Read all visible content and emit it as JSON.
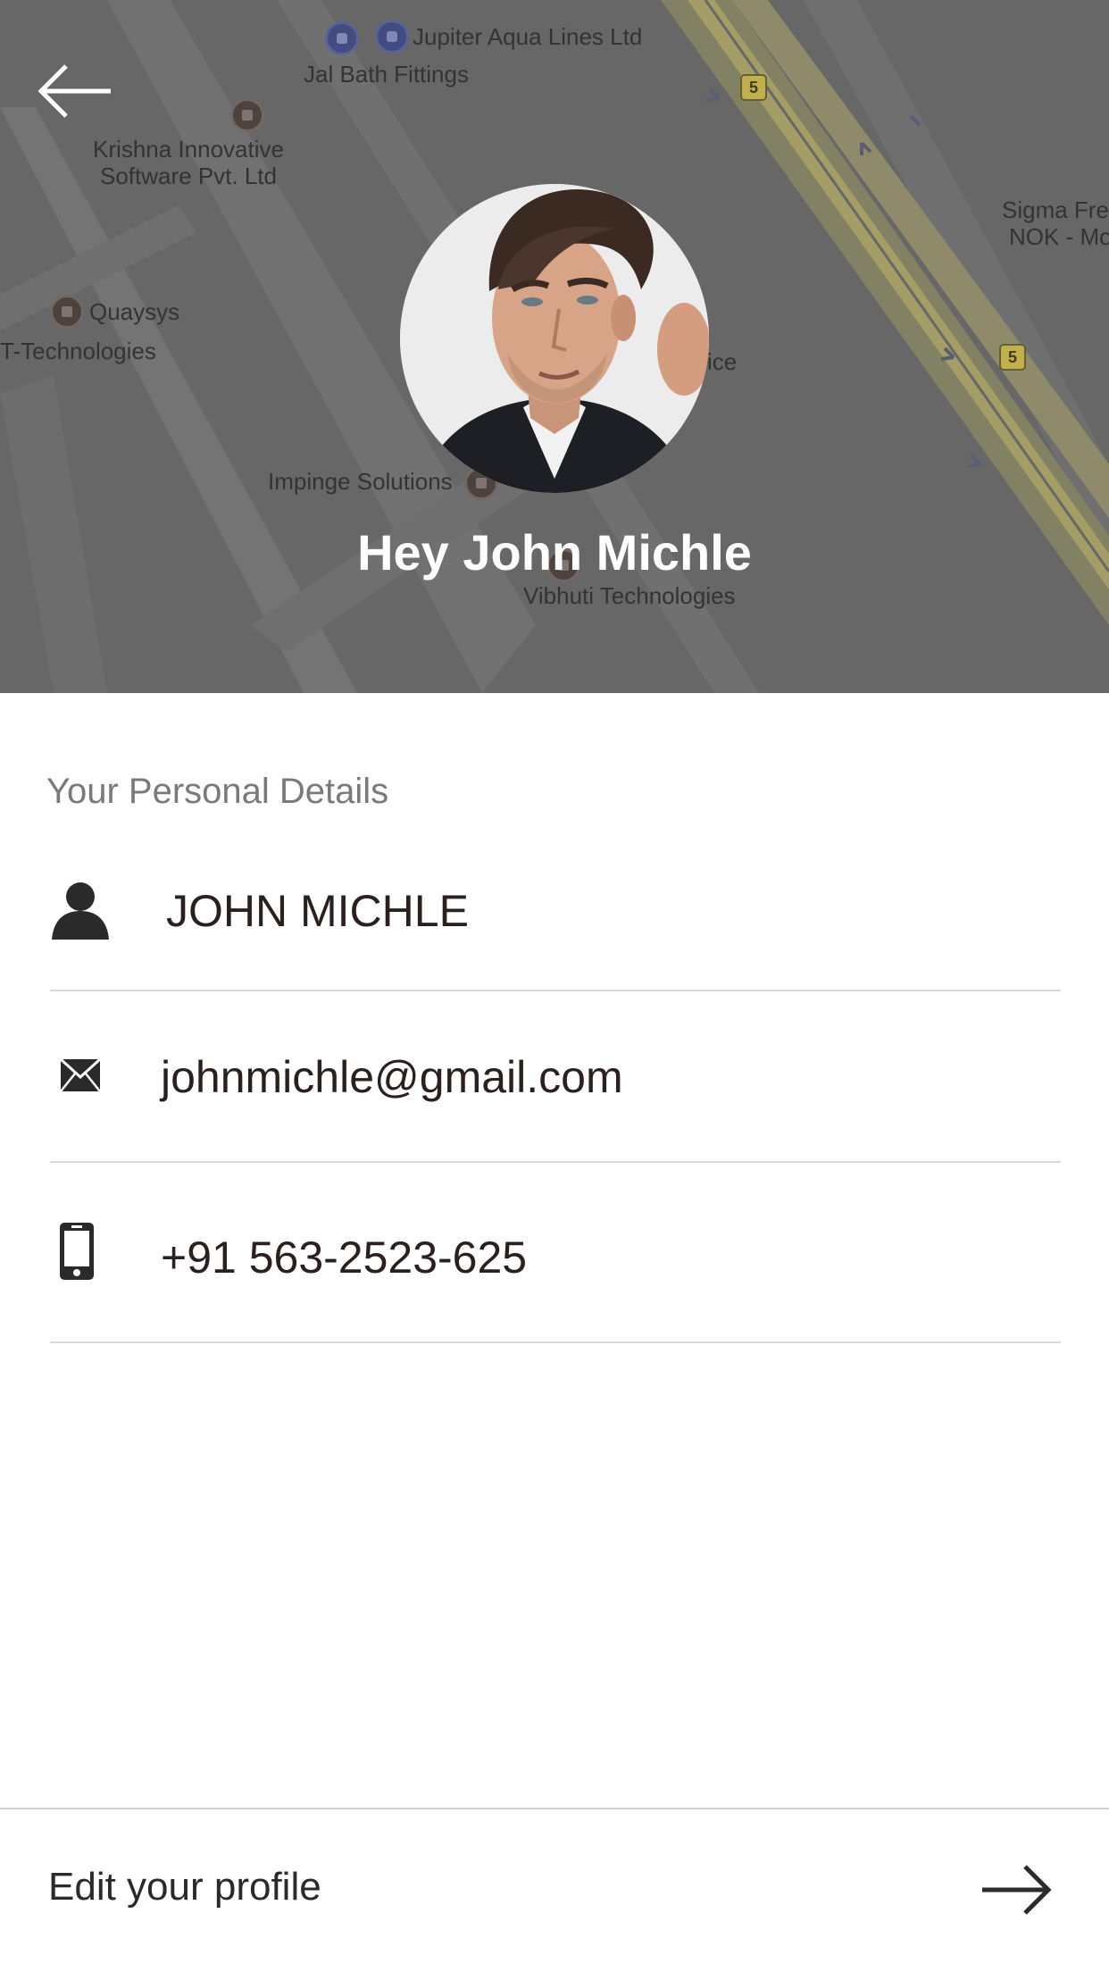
{
  "header": {
    "greeting": "Hey John Michle",
    "map_labels": {
      "jupiter": "Jupiter Aqua Lines Ltd",
      "jal": "Jal Bath Fittings",
      "krishna_1": "Krishna Innovative",
      "krishna_2": "Software Pvt. Ltd",
      "sigma_1": "Sigma Fre",
      "sigma_2": "NOK - Mo",
      "quaysys": "Quaysys",
      "t_tech": "T-Technologies",
      "office": "ffice",
      "impinge": "Impinge Solutions",
      "vibhuti": "Vibhuti Technologies",
      "road_5a": "5",
      "road_5b": "5"
    }
  },
  "details": {
    "section_title": "Your Personal Details",
    "name": "JOHN MICHLE",
    "email": "johnmichle@gmail.com",
    "phone": "+91 563-2523-625"
  },
  "footer": {
    "edit_label": "Edit your profile"
  },
  "icons": {
    "back": "arrow-left-icon",
    "name": "person-icon",
    "email": "envelope-icon",
    "phone": "mobile-phone-icon",
    "edit": "arrow-right-icon"
  },
  "colors": {
    "header_bg": "#6b6b6b",
    "road_yellow": "#b5ad6a",
    "text_dark": "#2a211e",
    "section_gray": "#7a7a7a",
    "divider": "#d9d9d9"
  }
}
